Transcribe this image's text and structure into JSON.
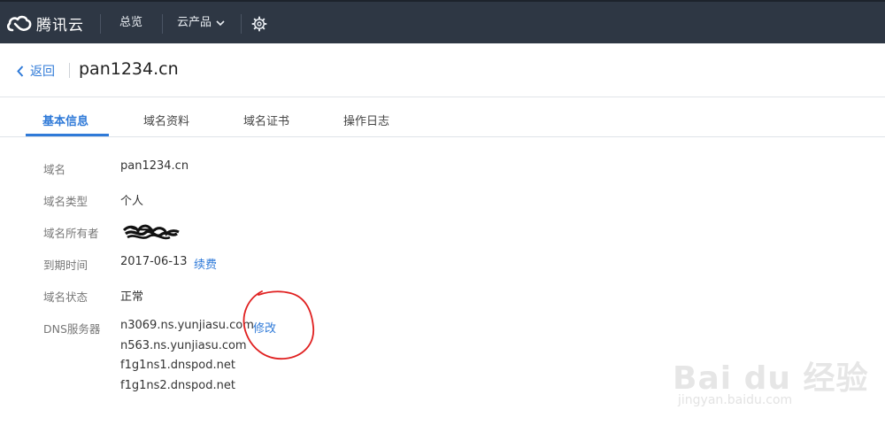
{
  "topbar": {
    "brand": "腾讯云",
    "nav": {
      "overview": "总览",
      "products": "云产品"
    }
  },
  "header": {
    "back_label": "返回",
    "title": "pan1234.cn"
  },
  "tabs": [
    {
      "label": "基本信息",
      "active": true
    },
    {
      "label": "域名资料",
      "active": false
    },
    {
      "label": "域名证书",
      "active": false
    },
    {
      "label": "操作日志",
      "active": false
    }
  ],
  "info": {
    "domain": {
      "label": "域名",
      "value": "pan1234.cn"
    },
    "type": {
      "label": "域名类型",
      "value": "个人"
    },
    "owner": {
      "label": "域名所有者"
    },
    "expiry": {
      "label": "到期时间",
      "value": "2017-06-13",
      "action": "续费"
    },
    "status": {
      "label": "域名状态",
      "value": "正常"
    },
    "dns": {
      "label": "DNS服务器",
      "servers": [
        "n3069.ns.yunjiasu.com",
        "n563.ns.yunjiasu.com",
        "f1g1ns1.dnspod.net",
        "f1g1ns2.dnspod.net"
      ],
      "action": "修改"
    }
  },
  "watermark": {
    "main": "Bai du 经验",
    "sub": "jingyan.baidu.com"
  },
  "colors": {
    "topbar": "#2e3744",
    "accent": "#2f7ad8",
    "annotation": "#e02020"
  }
}
